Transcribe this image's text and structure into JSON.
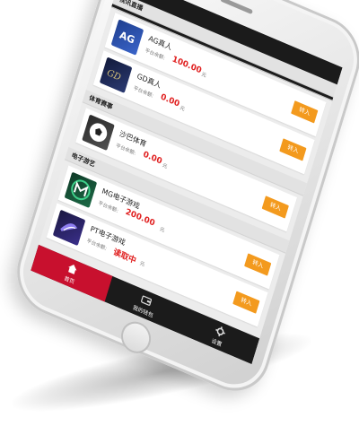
{
  "colors": {
    "accent": "#f39a1e",
    "active_tab": "#c8102e",
    "balance": "#e02020",
    "bar": "#1b1b1b"
  },
  "sections": [
    {
      "title": "视讯直播",
      "items": [
        {
          "name": "AG真人",
          "balance_label": "平台余额:",
          "balance": "100.00",
          "unit": "元",
          "button": "转入",
          "icon": "ag-logo-icon"
        },
        {
          "name": "GD真人",
          "balance_label": "平台余额:",
          "balance": "0.00",
          "unit": "元",
          "button": "转入",
          "icon": "gd-logo-icon"
        }
      ]
    },
    {
      "title": "体育赛事",
      "items": [
        {
          "name": "沙巴体育",
          "balance_label": "平台余额:",
          "balance": "0.00",
          "unit": "元",
          "button": "转入",
          "icon": "soccer-ball-icon"
        }
      ]
    },
    {
      "title": "电子游艺",
      "items": [
        {
          "name": "MG电子游戏",
          "balance_label": "平台余额:",
          "balance": "200.00",
          "unit": "元",
          "button": "转入",
          "icon": "mg-logo-icon"
        },
        {
          "name": "PT电子游戏",
          "balance_label": "平台余额:",
          "balance": "读取中",
          "unit": "元",
          "button": "转入",
          "icon": "pt-logo-icon"
        }
      ]
    }
  ],
  "tabbar": {
    "tabs": [
      {
        "label": "首页",
        "icon": "home-icon",
        "active": true
      },
      {
        "label": "我的钱包",
        "icon": "wallet-icon",
        "active": false
      },
      {
        "label": "设置",
        "icon": "gear-icon",
        "active": false
      }
    ]
  }
}
